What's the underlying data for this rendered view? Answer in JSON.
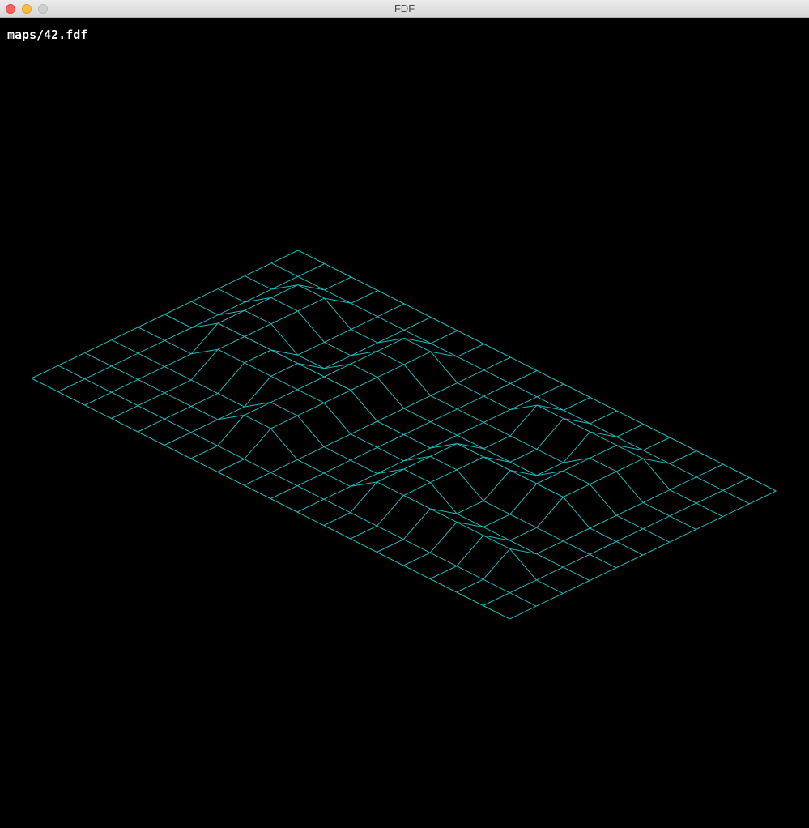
{
  "window": {
    "title": "FDF"
  },
  "overlay": {
    "filename": "maps/42.fdf"
  },
  "colors": {
    "background": "#000000",
    "wireframe": "#1fb8b8",
    "overlay_text": "#ffffff"
  },
  "map": {
    "rows": 11,
    "cols": 19,
    "heights": [
      [
        0,
        0,
        0,
        0,
        0,
        0,
        0,
        0,
        0,
        0,
        0,
        0,
        0,
        0,
        0,
        0,
        0,
        0,
        0
      ],
      [
        0,
        0,
        0,
        0,
        0,
        0,
        0,
        0,
        0,
        0,
        0,
        0,
        0,
        0,
        0,
        0,
        0,
        0,
        0
      ],
      [
        0,
        0,
        10,
        10,
        0,
        0,
        10,
        10,
        0,
        0,
        0,
        10,
        10,
        10,
        10,
        10,
        0,
        0,
        0
      ],
      [
        0,
        0,
        10,
        10,
        0,
        0,
        10,
        10,
        0,
        0,
        0,
        0,
        0,
        0,
        10,
        10,
        0,
        0,
        0
      ],
      [
        0,
        0,
        10,
        10,
        0,
        0,
        10,
        10,
        0,
        0,
        0,
        0,
        0,
        0,
        10,
        10,
        0,
        0,
        0
      ],
      [
        0,
        0,
        10,
        10,
        10,
        10,
        10,
        10,
        0,
        0,
        0,
        10,
        10,
        10,
        10,
        10,
        0,
        0,
        0
      ],
      [
        0,
        0,
        0,
        10,
        10,
        10,
        10,
        10,
        0,
        0,
        0,
        10,
        10,
        0,
        0,
        0,
        0,
        0,
        0
      ],
      [
        0,
        0,
        0,
        0,
        0,
        0,
        10,
        10,
        0,
        0,
        0,
        10,
        10,
        0,
        0,
        0,
        0,
        0,
        0
      ],
      [
        0,
        0,
        0,
        0,
        0,
        0,
        10,
        10,
        0,
        0,
        0,
        10,
        10,
        10,
        10,
        10,
        10,
        0,
        0
      ],
      [
        0,
        0,
        0,
        0,
        0,
        0,
        0,
        0,
        0,
        0,
        0,
        0,
        0,
        0,
        0,
        0,
        0,
        0,
        0
      ],
      [
        0,
        0,
        0,
        0,
        0,
        0,
        0,
        0,
        0,
        0,
        0,
        0,
        0,
        0,
        0,
        0,
        0,
        0,
        0
      ]
    ]
  }
}
